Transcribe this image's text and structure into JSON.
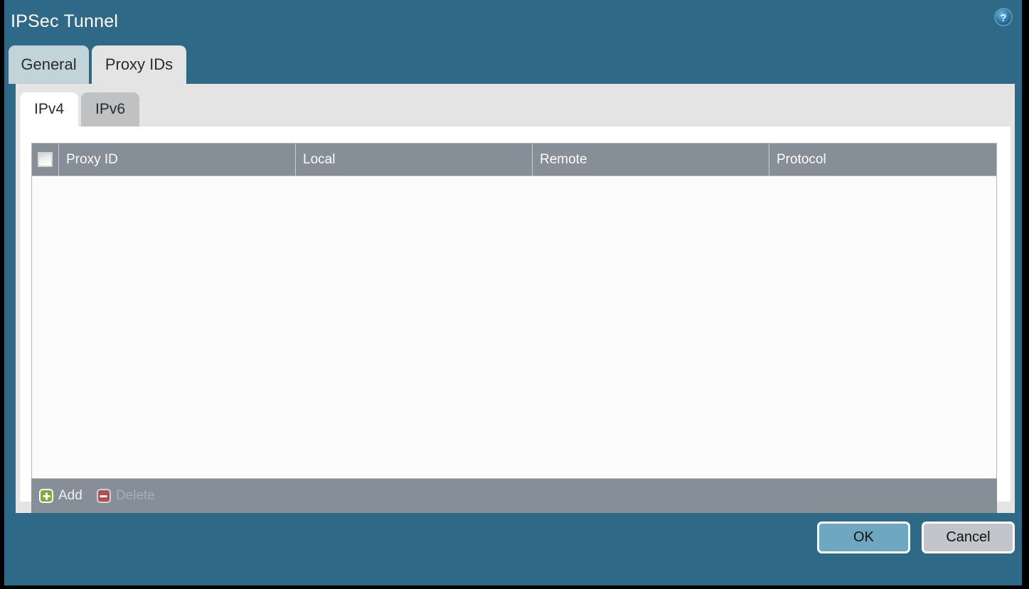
{
  "window": {
    "title": "IPSec Tunnel",
    "help_icon": "help-question-icon",
    "accent_color": "#2e6a87"
  },
  "top_tabs": [
    {
      "label": "General",
      "active": false
    },
    {
      "label": "Proxy IDs",
      "active": true
    }
  ],
  "inner_tabs": [
    {
      "label": "IPv4",
      "active": true
    },
    {
      "label": "IPv6",
      "active": false
    }
  ],
  "table": {
    "select_all_checkbox": "",
    "columns": [
      "Proxy ID",
      "Local",
      "Remote",
      "Protocol"
    ],
    "rows": [],
    "empty": true
  },
  "table_toolbar": {
    "add": {
      "label": "Add",
      "icon": "plus-icon",
      "enabled": true
    },
    "delete": {
      "label": "Delete",
      "icon": "minus-icon",
      "enabled": false
    }
  },
  "footer": {
    "ok_label": "OK",
    "cancel_label": "Cancel"
  },
  "colors": {
    "title_bar": "#2e6a87",
    "tab_active": "#e4e4e4",
    "tab_inactive": "#c2d3da",
    "table_header": "#868e98",
    "ok_button": "#6ea7c0",
    "cancel_button": "#c3c5ca",
    "add_icon": "#7fad36",
    "delete_icon": "#b05050"
  }
}
